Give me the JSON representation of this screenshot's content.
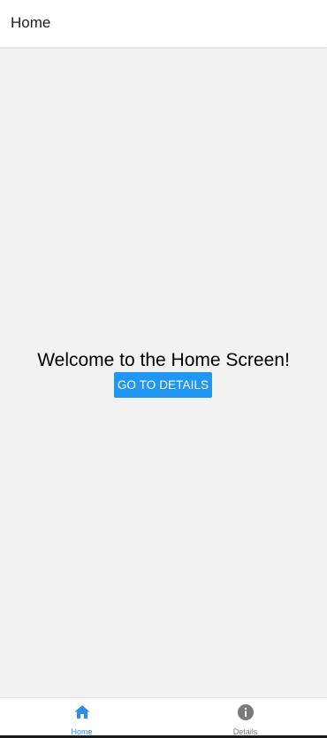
{
  "header": {
    "title": "Home"
  },
  "main": {
    "welcome_text": "Welcome to the Home Screen!",
    "button_label": "GO TO DETAILS"
  },
  "tabs": [
    {
      "label": "Home",
      "icon": "home-icon",
      "active": true
    },
    {
      "label": "Details",
      "icon": "info-icon",
      "active": false
    }
  ],
  "colors": {
    "accent": "#2196f3",
    "active_tab": "#2b8fe8",
    "inactive_tab": "#7a7a7a",
    "background": "#f2f2f2"
  }
}
